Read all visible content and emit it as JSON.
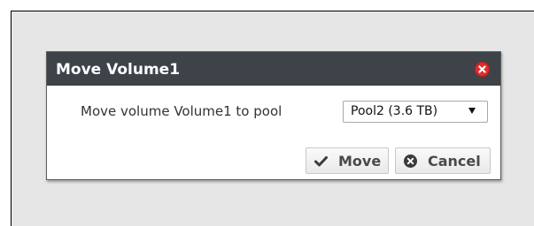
{
  "dialog": {
    "title": "Move Volume1",
    "prompt": "Move volume Volume1 to pool",
    "pool_select": {
      "selected": "Pool2 (3.6 TB)"
    },
    "buttons": {
      "move_label": "Move",
      "cancel_label": "Cancel"
    }
  },
  "icons": {
    "close": "close-circle-icon",
    "move": "checkmark-icon",
    "cancel": "cancel-circle-icon"
  },
  "colors": {
    "header_bg": "#3e434a",
    "close_red": "#e02d2d",
    "backdrop": "#e6e6e6"
  }
}
